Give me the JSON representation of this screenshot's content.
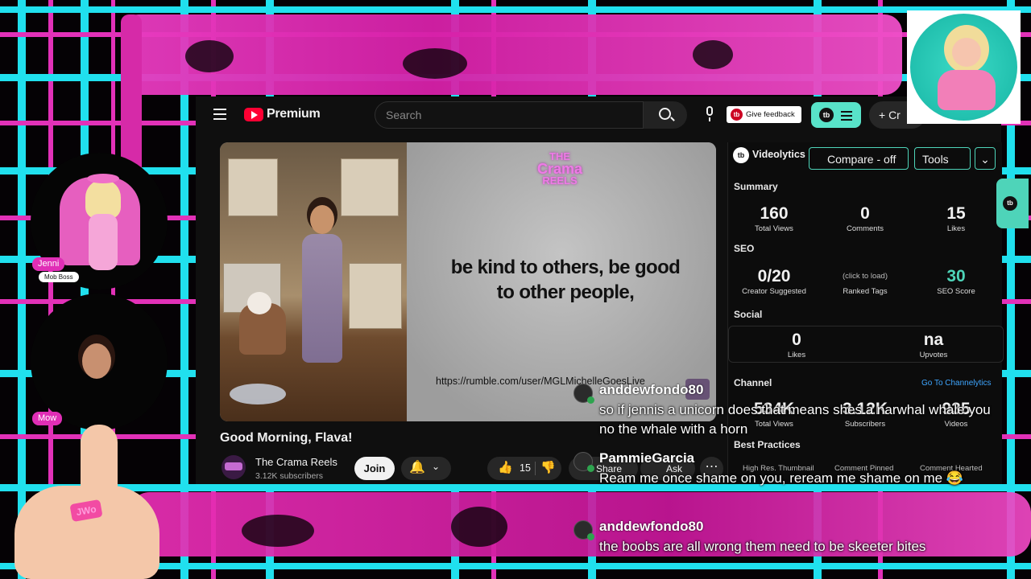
{
  "youtube": {
    "brand": "Premium",
    "search_placeholder": "Search",
    "feedback_label": "Give feedback",
    "create_label": "+ Cr",
    "video_title": "Good Morning, Flava!",
    "channel_name": "The Crama Reels",
    "channel_subs": "3.12K subscribers",
    "join_label": "Join",
    "like_count": "15",
    "share_label": "Share",
    "ask_label": "Ask",
    "more_label": "⋯",
    "slide_brand_line1": "THE",
    "slide_brand_line2": "Crama",
    "slide_brand_line3": "REELS",
    "slide_text": "be kind to others, be good to other people,",
    "slide_url": "https://rumble.com/user/MGLMichelleGoesLive"
  },
  "videolytics": {
    "title": "Videolytics",
    "compare_label": "Compare - off",
    "tools_label": "Tools",
    "sections": {
      "summary": "Summary",
      "seo": "SEO",
      "social": "Social",
      "channel": "Channel",
      "best_practices": "Best Practices"
    },
    "summary": [
      {
        "value": "160",
        "label": "Total Views"
      },
      {
        "value": "0",
        "label": "Comments"
      },
      {
        "value": "15",
        "label": "Likes"
      }
    ],
    "seo": [
      {
        "value": "0/20",
        "label": "Creator Suggested"
      },
      {
        "value": "(click to load)",
        "label": "Ranked Tags"
      },
      {
        "value": "30",
        "label": "SEO Score"
      }
    ],
    "social": [
      {
        "value": "0",
        "label": "Likes"
      },
      {
        "value": "na",
        "label": "Upvotes"
      }
    ],
    "channel_link": "Go To Channelytics",
    "channel": [
      {
        "value": "534K",
        "label": "Total Views"
      },
      {
        "value": "3.12K",
        "label": "Subscribers"
      },
      {
        "value": "935",
        "label": "Videos"
      }
    ],
    "best_practices": [
      "High Res. Thumbnail",
      "Comment Pinned",
      "Comment Hearted"
    ]
  },
  "stream": {
    "cam1_name": "Jenni",
    "cam1_role": "Mob Boss",
    "cam2_name": "Mow",
    "ring_text": "JWo"
  },
  "chat": [
    {
      "user": "anddewfondo80",
      "text": "so if jennis a unicorn does that means shes a narwhal whale you no the whale with a horn"
    },
    {
      "user": "PammieGarcia",
      "text": "Ream me once shame on you, reream me shame on me 😂"
    },
    {
      "user": "anddewfondo80",
      "text": "the boobs are all wrong them need to be skeeter bites"
    }
  ],
  "colors": {
    "cyan": "#22e6f0",
    "magenta": "#e02eb6",
    "teal_accent": "#4ed4b9",
    "youtube_red": "#ff0033"
  }
}
